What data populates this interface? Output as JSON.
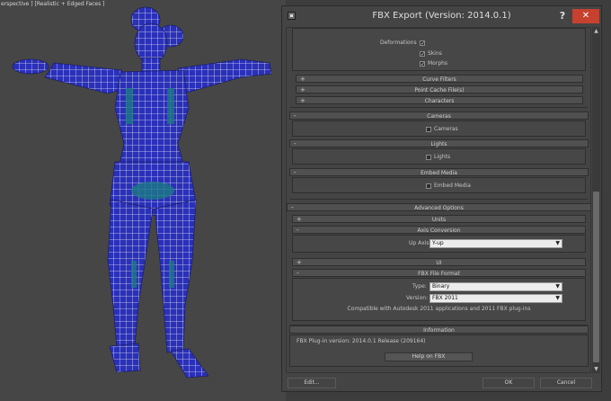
{
  "viewport": {
    "label": "erspective ] [Realistic + Edged Faces ]",
    "colors": {
      "background": "#464646",
      "mesh": "#2a30b8",
      "wire": "#d9ddf2"
    }
  },
  "dialog": {
    "title": "FBX Export (Version: 2014.0.1)",
    "help_label": "?",
    "close_label": "✕",
    "scroll_up": "▲",
    "scroll_down": "▼",
    "deformations": {
      "label": "Deformations",
      "skins_label": "Skins",
      "morphs_label": "Morphs"
    },
    "sections": {
      "curve_filters": "Curve Filters",
      "point_cache": "Point Cache File(s)",
      "characters": "Characters",
      "cameras": "Cameras",
      "cameras_cb": "Cameras",
      "lights": "Lights",
      "lights_cb": "Lights",
      "embed_media": "Embed Media",
      "embed_media_cb": "Embed Media",
      "advanced": "Advanced Options",
      "units": "Units",
      "axis_conversion": "Axis Conversion",
      "up_axis_label": "Up Axis:",
      "up_axis_value": "Y-up",
      "ui": "UI",
      "fbx_file_format": "FBX File Format",
      "type_label": "Type:",
      "type_value": "Binary",
      "version_label": "Version:",
      "version_value": "FBX 2011",
      "compat_text": "Compatible with Autodesk 2011 applications and 2011 FBX plug-ins",
      "information": "Information",
      "plugin_version": "FBX Plug-in version: 2014.0.1 Release (209164)",
      "help_on_fbx": "Help on FBX"
    },
    "plus": "+",
    "minus": "-",
    "check": "✓",
    "footer": {
      "edit": "Edit...",
      "ok": "OK",
      "cancel": "Cancel"
    }
  }
}
